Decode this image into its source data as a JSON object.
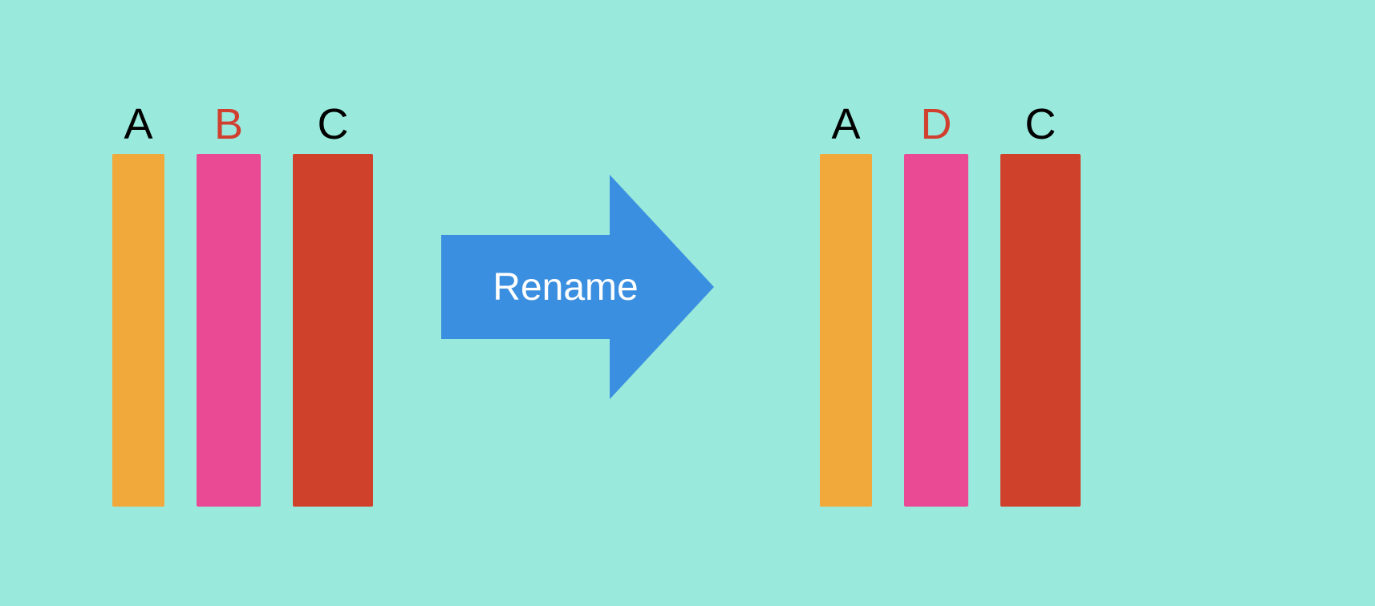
{
  "action_label": "Rename",
  "colors": {
    "background": "#99e9dc",
    "arrow": "#3b8fe0",
    "label_default": "#000000",
    "label_highlight": "#d13f2f",
    "bar_A": "#f1a93c",
    "bar_B": "#e94a93",
    "bar_C": "#d0412c"
  },
  "left_columns": [
    {
      "label": "A",
      "highlight": false,
      "color_key": "bar_A",
      "width_rank": 0
    },
    {
      "label": "B",
      "highlight": true,
      "color_key": "bar_B",
      "width_rank": 1
    },
    {
      "label": "C",
      "highlight": false,
      "color_key": "bar_C",
      "width_rank": 2
    }
  ],
  "right_columns": [
    {
      "label": "A",
      "highlight": false,
      "color_key": "bar_A",
      "width_rank": 0
    },
    {
      "label": "D",
      "highlight": true,
      "color_key": "bar_B",
      "width_rank": 1
    },
    {
      "label": "C",
      "highlight": false,
      "color_key": "bar_C",
      "width_rank": 2
    }
  ]
}
